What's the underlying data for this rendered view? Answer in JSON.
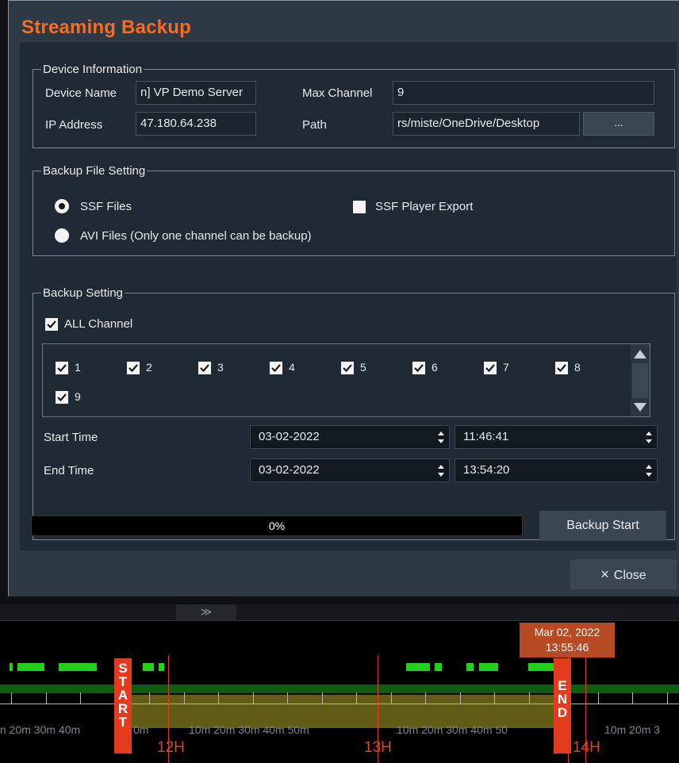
{
  "dialog": {
    "title": "Streaming Backup",
    "close_label": "Close",
    "close_glyph": "×"
  },
  "device_info": {
    "legend": "Device Information",
    "device_name_label": "Device Name",
    "device_name_value": "n] VP Demo Server",
    "ip_label": "IP Address",
    "ip_value": "47.180.64.238",
    "max_channel_label": "Max Channel",
    "max_channel_value": "9",
    "path_label": "Path",
    "path_value": "rs/miste/OneDrive/Desktop",
    "browse_label": "..."
  },
  "file_setting": {
    "legend": "Backup File Setting",
    "ssf_label": "SSF Files",
    "ssf_selected": true,
    "avi_label": "AVI Files (Only one channel can be backup)",
    "avi_selected": false,
    "player_export_label": "SSF Player Export",
    "player_export_checked": false
  },
  "backup_setting": {
    "legend": "Backup Setting",
    "all_channel_label": "ALL Channel",
    "all_channel_checked": true,
    "channels": [
      "1",
      "2",
      "3",
      "4",
      "5",
      "6",
      "7",
      "8",
      "9"
    ],
    "start_label": "Start Time",
    "start_date": "03-02-2022",
    "start_time": "11:46:41",
    "end_label": "End Time",
    "end_date": "03-02-2022",
    "end_time": "13:54:20"
  },
  "progress": {
    "value": 0,
    "text": "0%"
  },
  "backup_start_label": "Backup Start",
  "timeline": {
    "collapse_glyph": "≫",
    "tooltip_date": "Mar 02, 2022",
    "tooltip_time": "13:55:46",
    "start_flag": "START",
    "end_flag": "END",
    "hour_labels": [
      "12H",
      "13H",
      "14H"
    ],
    "minute_labels": [
      "n 20m 30m 40m",
      "0m",
      "10m 20m 30m 40m 50m",
      "10m 20m 30m 40m 50",
      "10m 20m 3"
    ],
    "colors": {
      "record": "#22d11a",
      "marker": "#e23b1d",
      "range": "#6b6719"
    }
  }
}
